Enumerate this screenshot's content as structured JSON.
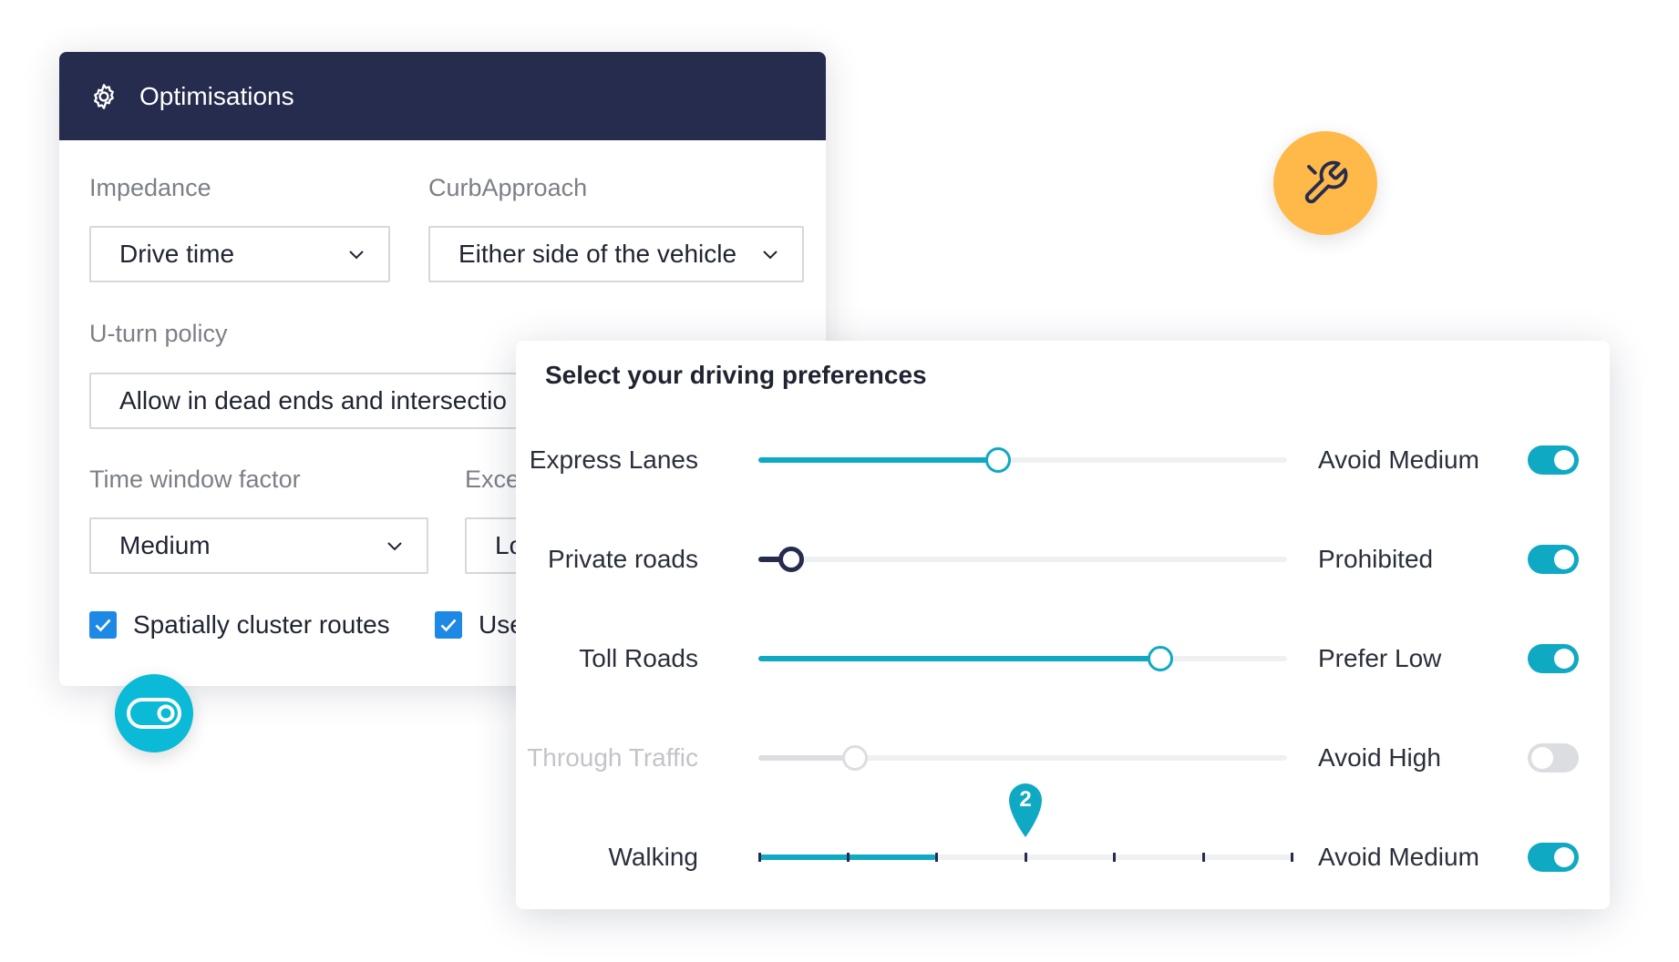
{
  "optimisations": {
    "title": "Optimisations",
    "header_icon": "gear-icon",
    "impedance": {
      "label": "Impedance",
      "value": "Drive time"
    },
    "curb_approach": {
      "label": "CurbApproach",
      "value": "Either side of the vehicle"
    },
    "uturn_policy": {
      "label": "U-turn policy",
      "value": "Allow in dead ends and intersectio"
    },
    "time_window_factor": {
      "label": "Time window factor",
      "value": "Medium"
    },
    "excess": {
      "label": "Exce",
      "value": "Lo"
    },
    "checkboxes": [
      {
        "label": "Spatially cluster routes",
        "checked": true
      },
      {
        "label": "Use",
        "checked": true
      }
    ]
  },
  "floating_icons": {
    "toggle": {
      "icon": "toggle-icon",
      "color": "#0bbad6"
    },
    "wrench": {
      "icon": "wrench-icon",
      "color": "#ffb948"
    }
  },
  "preferences": {
    "title": "Select your driving preferences",
    "rows": [
      {
        "label": "Express Lanes",
        "level": 0.45,
        "value": "Avoid Medium",
        "enabled": true
      },
      {
        "label": "Private roads",
        "level": 0.06,
        "value": "Prohibited",
        "enabled": true
      },
      {
        "label": "Toll Roads",
        "level": 0.76,
        "value": "Prefer Low",
        "enabled": true
      },
      {
        "label": "Through Traffic",
        "level": 0.18,
        "value": "Avoid High",
        "enabled": false
      },
      {
        "label": "Walking",
        "step": "2",
        "value": "Avoid Medium",
        "enabled": true
      }
    ]
  },
  "colors": {
    "header_bg": "#262c4e",
    "accent": "#10a9c4",
    "checkbox": "#1e88e5"
  }
}
